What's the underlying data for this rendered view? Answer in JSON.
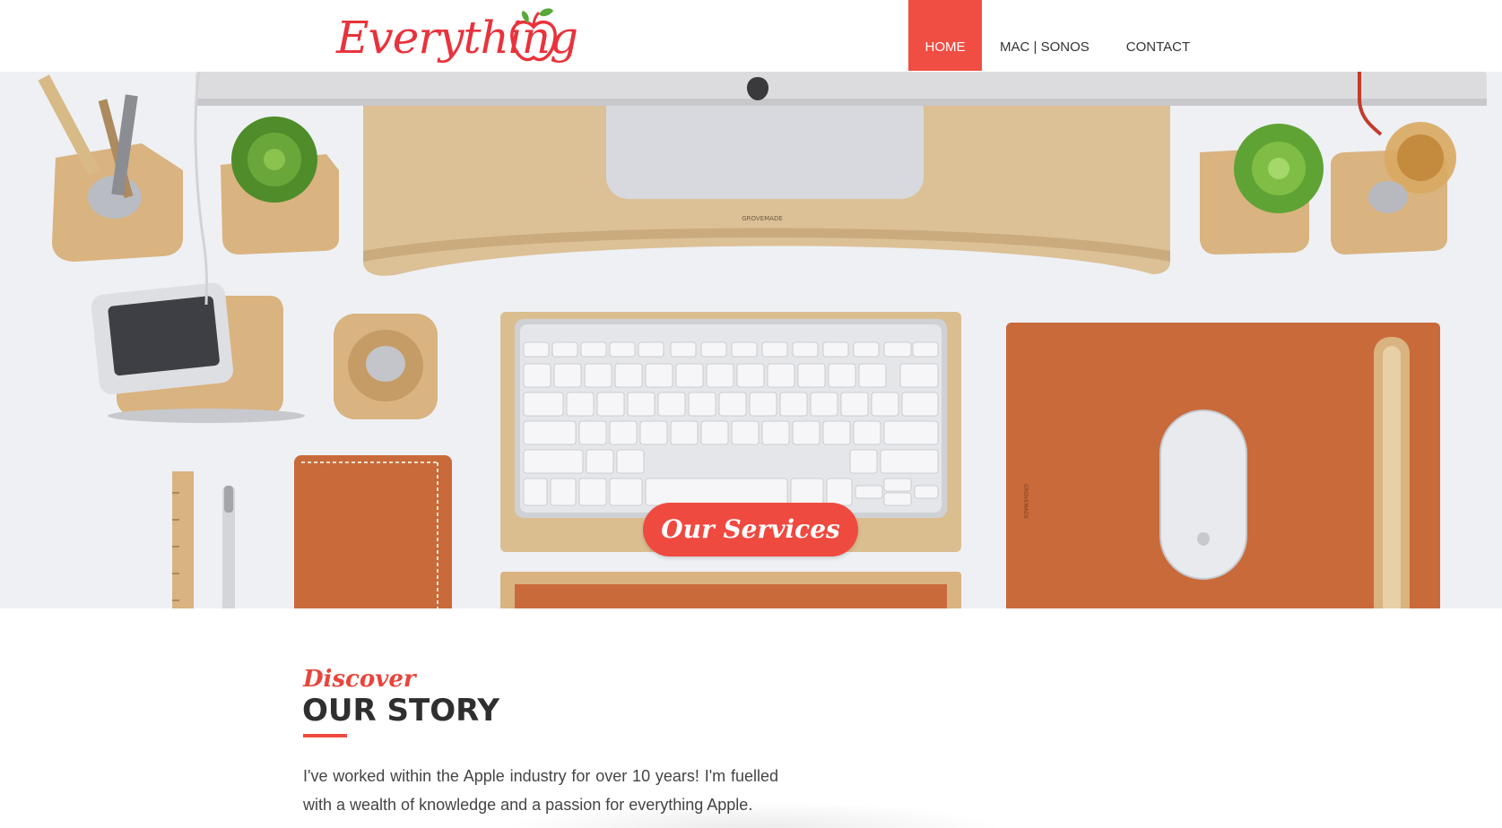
{
  "header": {
    "logo_text": "Everything",
    "logo_icon": "apple-logo-icon",
    "nav": {
      "home": "HOME",
      "mac_sonos": "MAC | SONOS",
      "contact": "CONTACT"
    }
  },
  "hero": {
    "image": "desk-setup-photo",
    "cta_label": "Our Services",
    "keyboard_brand": "GROVEMADE"
  },
  "story": {
    "kicker": "Discover",
    "title": "OUR STORY",
    "body": "I've worked within the Apple industry for over 10 years! I'm fuelled with a wealth of knowledge and a passion for everything Apple."
  },
  "colors": {
    "accent": "#ef4a40",
    "text_dark": "#2f2f2f",
    "desk_background": "#eef0f4",
    "wood": "#d9b380",
    "leather": "#c96a3a"
  }
}
